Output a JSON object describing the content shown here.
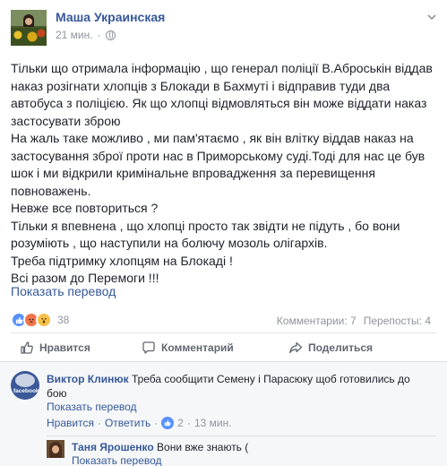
{
  "post": {
    "author": "Маша Украинская",
    "time": "21 мин.",
    "text_lines": [
      "Тільки що отримала інформацію , що генерал поліції В.Аброськін віддав",
      "наказ розігнати хлопців з Блокади в Бахмуті і відправив туди два",
      "автобуса з поліцією. Як що хлопці відмовляться він може віддати наказ",
      "застосувати зброю",
      "На жаль таке можливо , ми пам'ятаємо , як він влітку віддав наказ на",
      "застосування зброї проти нас в Приморському суді.Тоді для нас це був",
      "шок і ми відкрили кримінальне впровадження за перевищення",
      "повноважень.",
      "Невже все повториться ?",
      "Тільки я впевнена , що хлопці просто так звідти не підуть , бо вони",
      "розуміють , що наступили на болючу мозоль олігархів.",
      "Треба підтримку хлопцям на Блокаді !",
      "Всі разом до Перемоги !!!"
    ],
    "translate_label": "Показать перевод",
    "reactions_count": "38",
    "comments_label": "Комментарии: 7",
    "shares_label": "Перепосты: 4",
    "actions": {
      "like": "Нравится",
      "comment": "Комментарий",
      "share": "Поделиться"
    }
  },
  "comment": {
    "author": "Виктор Клинюк",
    "text": "Треба сообщити Семену і Парасюку щоб готовились до бою",
    "avatar_caption": "facebook",
    "translate_label": "Показать перевод",
    "like_label": "Нравится",
    "reply_label": "Ответить",
    "likes_count": "2",
    "time": "13 мин."
  },
  "reply": {
    "author": "Таня Ярошенко",
    "text": "Вони вже знають (",
    "translate_label": "Показать перевод"
  },
  "colors": {
    "link": "#365899",
    "text": "#1d2129",
    "muted": "#90949c",
    "like_blue": "#5890ff"
  }
}
